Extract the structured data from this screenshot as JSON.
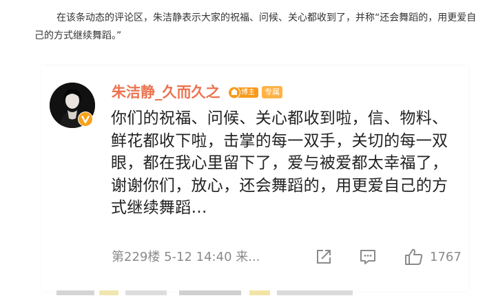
{
  "article": {
    "intro": "在该条动态的评论区，朱洁静表示大家的祝福、问候、关心都收到了，并称“还会舞蹈的，用更爱自己的方式继续舞蹈。”"
  },
  "comment": {
    "username": "朱洁静_久而久之",
    "badge_blogger": "博主",
    "badge_exclusive": "专属",
    "text": "你们的祝福、问候、关心都收到啦，信、物料、鲜花都收下啦，击掌的每一双手，关切的每一双眼，都在我心里留下了，爱与被爱都太幸福了，谢谢你们，放心，还会舞蹈的，用更爱自己的方式继续舞蹈…",
    "meta": "第229楼 5-12 14:40 来...",
    "likes": "1767"
  },
  "icons": {
    "share": "share-icon",
    "reply": "comment-icon",
    "like": "thumbs-up-icon",
    "verified": "verified-v-icon"
  },
  "colors": {
    "username": "#eb7350",
    "text": "#222222",
    "meta": "#8a8a8a",
    "badge": "#ffb347"
  }
}
